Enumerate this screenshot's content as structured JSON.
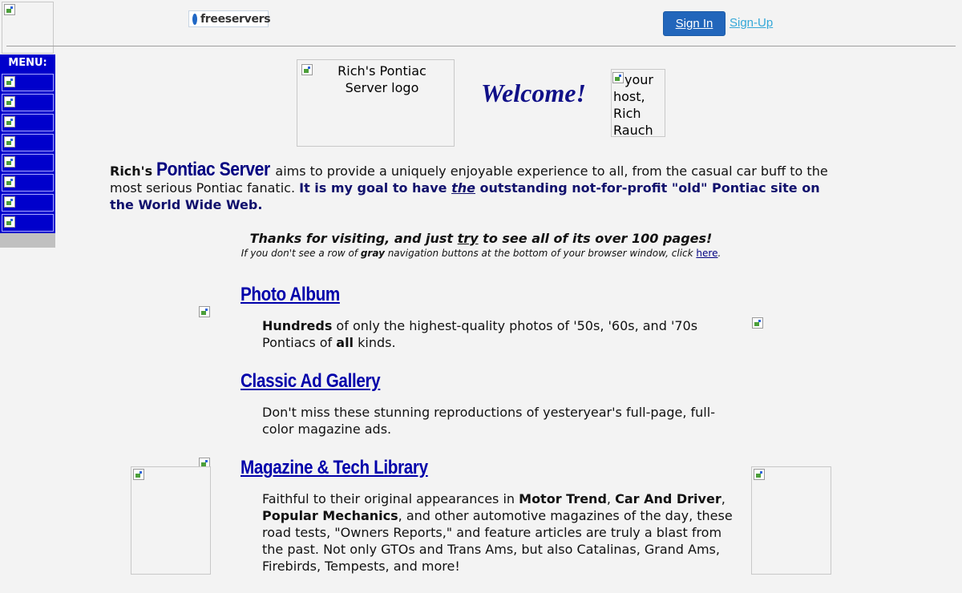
{
  "header": {
    "freeservers_logo": "freeservers",
    "sign_in": "Sign In",
    "sign_up": "Sign-Up"
  },
  "menu": {
    "title": "MENU:",
    "button_count": 8
  },
  "hero": {
    "logo_alt": "Rich's Pontiac Server logo",
    "welcome": "Welcome!",
    "host_alt": "your host, Rich Rauch"
  },
  "intro": {
    "rich": "Rich's",
    "site_name": "Pontiac Server",
    "text1": " aims to provide a uniquely enjoyable experience to all, from the casual car buff to the most serious Pontiac fanatic. ",
    "goal_a": "It is my goal to have ",
    "goal_em": "the",
    "goal_b": " outstanding not-for-profit \"old\" Pontiac site on the World Wide Web."
  },
  "thanks": {
    "a": "Thanks for visiting, and just ",
    "try": "try",
    "b": " to see all of its over 100 pages!"
  },
  "note": {
    "a": "If you don't see a row of ",
    "gray": "gray",
    "b": " navigation buttons at the bottom of your browser window, click ",
    "link": "here",
    "c": "."
  },
  "sections": {
    "photo": {
      "title": "Photo Album",
      "b1": "Hundreds",
      "t1": " of only the highest-quality photos of '50s, '60s, and '70s Pontiacs of ",
      "b2": "all",
      "t2": " kinds."
    },
    "ads": {
      "title": "Classic Ad Gallery",
      "text": "Don't miss these stunning reproductions of yesteryear's full-page, full-color magazine ads."
    },
    "library": {
      "title": "Magazine & Tech Library",
      "t1": "Faithful to their original appearances in ",
      "b1": "Motor Trend",
      "t2": ", ",
      "b2": "Car And Driver",
      "t3": ", ",
      "b3": "Popular Mechanics",
      "t4": ", and other automotive magazines of the day, these road tests, \"Owners Reports,\" and feature articles are truly a blast from the past. Not only GTOs and Trans Ams, but also Catalinas, Grand Ams, Firebirds, Tempests, and more!"
    }
  }
}
